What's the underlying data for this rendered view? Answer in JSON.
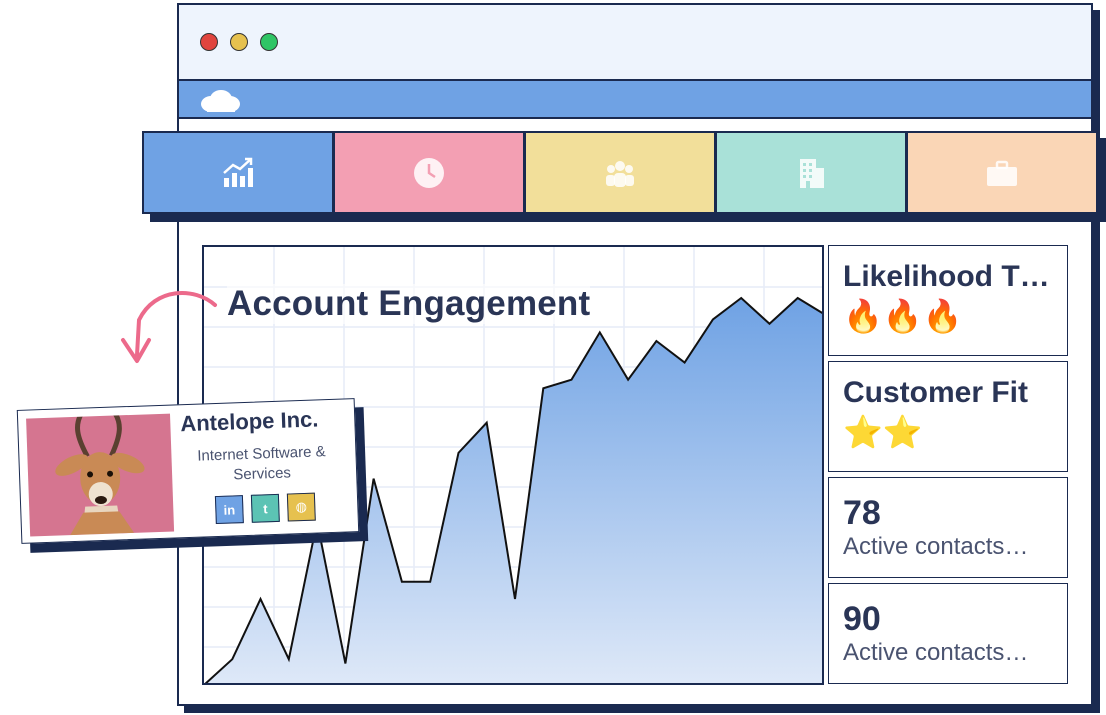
{
  "tabs": [
    {
      "icon": "chart-growth-icon",
      "color": "#6fa2e4"
    },
    {
      "icon": "clock-icon",
      "color": "#f39fb3"
    },
    {
      "icon": "people-icon",
      "color": "#f2df9a"
    },
    {
      "icon": "building-icon",
      "color": "#a9e1d8"
    },
    {
      "icon": "briefcase-icon",
      "color": "#fad6b6"
    }
  ],
  "chart_title": "Account Engagement",
  "chart_data": {
    "type": "area",
    "x": [
      0,
      1,
      2,
      3,
      4,
      5,
      6,
      7,
      8,
      9,
      10,
      11,
      12,
      13,
      14,
      15,
      16,
      17,
      18,
      19,
      20,
      21,
      22
    ],
    "values": [
      0,
      6,
      20,
      6,
      38,
      5,
      48,
      24,
      24,
      54,
      61,
      20,
      69,
      71,
      82,
      71,
      80,
      75,
      85,
      90,
      84,
      90,
      86
    ],
    "note": "relative engagement curve, no axes printed"
  },
  "cards": {
    "likelihood": {
      "title": "Likelihood T…",
      "icons": "🔥🔥🔥"
    },
    "fit": {
      "title": "Customer Fit",
      "icons": "⭐⭐"
    },
    "contacts1": {
      "number": "78",
      "label": "Active contacts…"
    },
    "contacts2": {
      "number": "90",
      "label": "Active contacts…"
    }
  },
  "company": {
    "name": "Antelope Inc.",
    "industry": "Internet Software & Services",
    "social": [
      {
        "icon": "linkedin-icon",
        "label": "in",
        "color": "#6fa2e4"
      },
      {
        "icon": "twitter-icon",
        "label": "t",
        "color": "#5cc3b4"
      },
      {
        "icon": "globe-icon",
        "label": "◍",
        "color": "#e6c14f"
      }
    ]
  }
}
